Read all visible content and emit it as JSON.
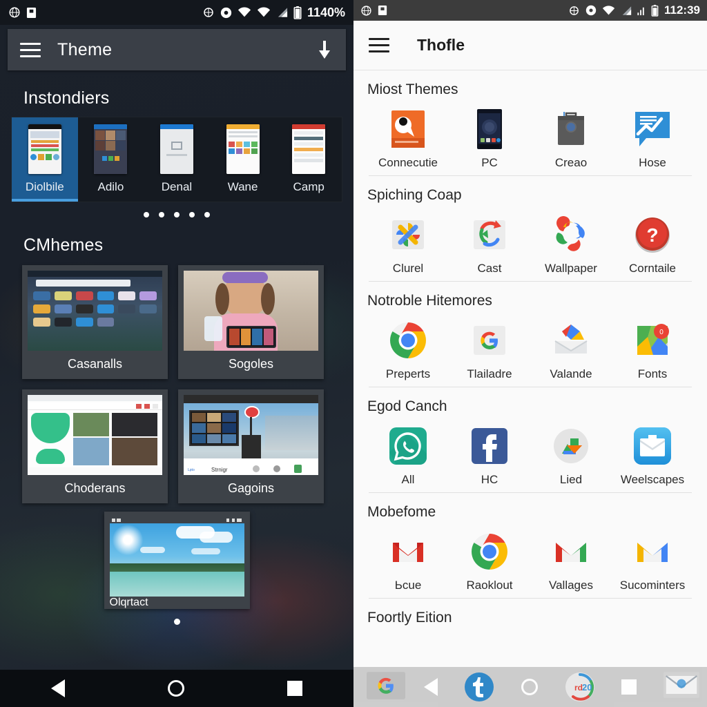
{
  "left_phone": {
    "status_bar": {
      "left_icons": [
        "globe-icon",
        "sim-card-icon"
      ],
      "right_icons": [
        "globe-sync-icon",
        "do-not-disturb-icon",
        "wifi-icon",
        "wifi-2-icon",
        "signal-icon",
        "battery-icon"
      ],
      "battery_text": "1140%"
    },
    "app_bar": {
      "menu_icon": "hamburger-menu-icon",
      "title": "Theme",
      "action_icon": "download-icon"
    },
    "sections": [
      {
        "title": "Instondiers",
        "items": [
          {
            "label": "Diolbile",
            "selected": true,
            "bar": "#111111",
            "body": "#f4f4f4"
          },
          {
            "label": "Adilo",
            "selected": false,
            "bar": "#1c6fc0",
            "body": "#3a3f52"
          },
          {
            "label": "Denal",
            "selected": false,
            "bar": "#1c78d0",
            "body": "#e8eaec"
          },
          {
            "label": "Wane",
            "selected": false,
            "bar": "#f0ad32",
            "body": "#fbfbfb"
          },
          {
            "label": "Camp",
            "selected": false,
            "bar": "#d13b30",
            "body": "#fcfcfc"
          }
        ],
        "page_dots": 5,
        "active_dot": 0
      },
      {
        "title": "CMhemes",
        "cards": [
          {
            "label": "Casanalls",
            "art": "desktop-mountains"
          },
          {
            "label": "Sogoles",
            "art": "girl-tablet-photo"
          },
          {
            "label": "Choderans",
            "art": "web-gallery-green"
          },
          {
            "label": "Gagoins",
            "art": "city-bridge-photo"
          }
        ]
      },
      {
        "title": "",
        "single_card": {
          "label": "Olqrtact",
          "art": "sunny-lake-wallpaper"
        },
        "page_dots": 1
      }
    ],
    "nav_bar": {
      "back": "back-triangle-icon",
      "home": "home-circle-icon",
      "recents": "recents-square-icon"
    }
  },
  "right_phone": {
    "status_bar": {
      "left_icons": [
        "globe-icon",
        "sim-card-icon"
      ],
      "right_icons": [
        "globe-sync-icon",
        "do-not-disturb-icon",
        "wifi-icon",
        "signal-icon",
        "signal-2-icon",
        "battery-icon"
      ],
      "clock": "112:39"
    },
    "app_bar": {
      "menu_icon": "hamburger-menu-icon",
      "title": "Thofle"
    },
    "sections": [
      {
        "title": "Miost Themes",
        "items": [
          {
            "label": "Connecutie",
            "icon": "orange-nine-app-icon"
          },
          {
            "label": "PC",
            "icon": "tablet-screen-icon"
          },
          {
            "label": "Creao",
            "icon": "toolbox-grey-icon"
          },
          {
            "label": "Hose",
            "icon": "blue-chat-chart-icon"
          }
        ]
      },
      {
        "title": "Spiching Coap",
        "items": [
          {
            "label": "Clurel",
            "icon": "google-photos-pinwheel-icon"
          },
          {
            "label": "Cast",
            "icon": "sync-arrows-icon"
          },
          {
            "label": "Wallpaper",
            "icon": "colorful-gears-icon"
          },
          {
            "label": "Corntaile",
            "icon": "red-question-mark-icon"
          }
        ]
      },
      {
        "title": "Notroble Hitemores",
        "items": [
          {
            "label": "Preperts",
            "icon": "chrome-browser-icon"
          },
          {
            "label": "Tlailadre",
            "icon": "google-g-icon"
          },
          {
            "label": "Valande",
            "icon": "inbox-envelope-icon"
          },
          {
            "label": "Fonts",
            "icon": "maps-pin-icon",
            "badge": "0"
          }
        ]
      },
      {
        "title": "Egod Canch",
        "items": [
          {
            "label": "All",
            "icon": "whatsapp-icon"
          },
          {
            "label": "HC",
            "icon": "facebook-icon"
          },
          {
            "label": "Lied",
            "icon": "photos-circle-icon"
          },
          {
            "label": "Weelscapes",
            "icon": "blue-briefcase-mail-icon"
          }
        ]
      },
      {
        "title": "Mobefome",
        "items": [
          {
            "label": "Ьcue",
            "icon": "gmail-red-icon"
          },
          {
            "label": "Raoklout",
            "icon": "chrome-browser-icon"
          },
          {
            "label": "Vallages",
            "icon": "gmail-green-icon"
          },
          {
            "label": "Sucominters",
            "icon": "gmail-yellow-icon"
          }
        ]
      },
      {
        "title": "Foortly Eition",
        "items": []
      }
    ],
    "nav_bar": {
      "dock_left_icon": "google-search-box-icon",
      "back": "back-triangle-icon",
      "dock_t_icon": "tumblr-t-icon",
      "home": "home-circle-icon",
      "dock_rd_icon": "rd20-circle-icon",
      "recents": "recents-square-icon",
      "dock_mail_icon": "mail-envelope-icon"
    }
  },
  "colors": {
    "left_appbar": "#3a3f47",
    "left_selected": "#1d5c93",
    "left_selected_underline": "#4a9fe0",
    "left_card": "#3d4248",
    "right_status": "#3c3c3c",
    "right_bg": "#fafafa",
    "right_navbar": "#c9c9c9"
  }
}
